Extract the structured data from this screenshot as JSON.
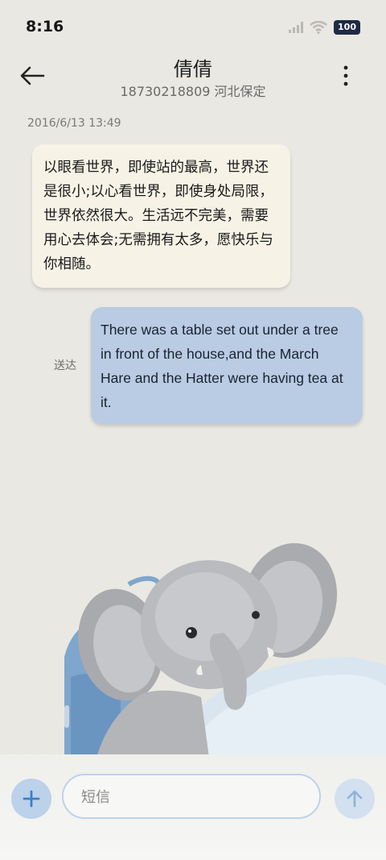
{
  "status_bar": {
    "time": "8:16",
    "battery": "100",
    "icons": [
      "signal-icon",
      "wifi-icon",
      "battery-icon"
    ]
  },
  "header": {
    "title": "倩倩",
    "subtitle": "18730218809 河北保定",
    "back_icon": "arrow-left-icon",
    "menu_icon": "more-vertical-icon"
  },
  "conversation": {
    "timestamp": "2016/6/13 13:49",
    "incoming_text": "以眼看世界，即使站的最高，世界还是很小;以心看世界，即使身处局限，世界依然很大。生活远不完美，需要用心去体会;无需拥有太多，愿快乐与你相随。",
    "outgoing_text": "There was a table set out under a tree in front of the house,and the March Hare and the Hatter were having tea at it.",
    "delivery_status": "送达"
  },
  "composer": {
    "placeholder": "短信",
    "add_icon": "plus-icon",
    "send_icon": "arrow-up-icon"
  },
  "colors": {
    "background": "#e9e8e2",
    "incoming_bubble": "#f6f3e6",
    "outgoing_bubble": "#b9cce3",
    "accent": "#3d7fc6"
  }
}
